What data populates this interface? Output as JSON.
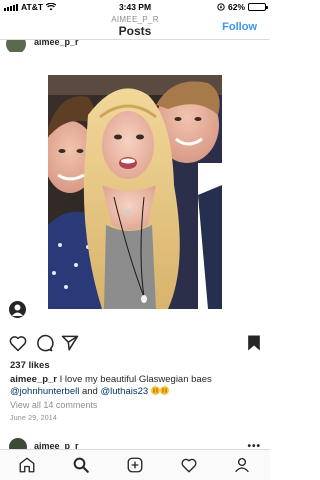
{
  "status_bar": {
    "carrier": "AT&T",
    "time": "3:43 PM",
    "battery_text": "62%",
    "battery_level": 0.62
  },
  "header": {
    "username": "AIMEE_P_R",
    "title": "Posts",
    "follow_label": "Follow"
  },
  "previous_post": {
    "username": "aimee_p_r"
  },
  "post": {
    "likes": "237 likes",
    "caption": {
      "username": "aimee_p_r",
      "text_before": "I love my beautiful Glaswegian baes",
      "mention_1": "@johnhunterbell",
      "connector": "and",
      "mention_2": "@luthais23"
    },
    "view_comments": "View all 14 comments",
    "date": "June 29, 2014"
  },
  "next_post": {
    "username": "aimee_p_r",
    "more_label": "•••"
  },
  "icons": {
    "like": "heart-icon",
    "comment": "comment-icon",
    "share": "paper-plane-icon",
    "save": "bookmark-icon",
    "home": "home-icon",
    "search": "search-icon",
    "new_post": "plus-square-icon",
    "activity": "heart-icon",
    "profile": "profile-icon"
  },
  "colors": {
    "accent": "#3897f0",
    "text": "#262626",
    "muted": "#8e8e8e",
    "mention": "#003569"
  }
}
